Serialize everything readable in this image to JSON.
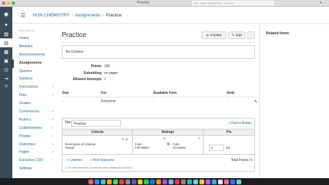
{
  "browser": {
    "tab_title": "Practice",
    "url": "ibe - WIBF 400000000 - Genuine",
    "colors": {
      "close": "#ff5f57",
      "min": "#febc2e",
      "max": "#28c840"
    }
  },
  "global_nav": {
    "items": [
      "account-icon",
      "dashboard-icon",
      "courses-icon",
      "calendar-icon",
      "inbox-icon",
      "history-icon",
      "commons-icon",
      "help-icon"
    ]
  },
  "breadcrumb": {
    "course": "HON CHEMISTRY",
    "section": "Assignments",
    "current": "Practice"
  },
  "course_nav": {
    "term": "2020-2021 S2",
    "items": [
      {
        "label": "Home",
        "hidden": false,
        "selected": false
      },
      {
        "label": "Modules",
        "hidden": false,
        "selected": false
      },
      {
        "label": "Announcements",
        "hidden": false,
        "selected": false
      },
      {
        "label": "Assignments",
        "hidden": false,
        "selected": true
      },
      {
        "label": "Quizzes",
        "hidden": false,
        "selected": false
      },
      {
        "label": "Syllabus",
        "hidden": false,
        "selected": false
      },
      {
        "label": "Discussions",
        "hidden": true,
        "selected": false
      },
      {
        "label": "Files",
        "hidden": true,
        "selected": false
      },
      {
        "label": "Grades",
        "hidden": false,
        "selected": false
      },
      {
        "label": "Conferences",
        "hidden": true,
        "selected": false
      },
      {
        "label": "Rubrics",
        "hidden": true,
        "selected": false
      },
      {
        "label": "Collaborations",
        "hidden": true,
        "selected": false
      },
      {
        "label": "People",
        "hidden": true,
        "selected": false
      },
      {
        "label": "Outcomes",
        "hidden": true,
        "selected": false
      },
      {
        "label": "Pages",
        "hidden": true,
        "selected": false
      },
      {
        "label": "Exclusive CSO",
        "hidden": true,
        "selected": false
      },
      {
        "label": "Settings",
        "hidden": false,
        "selected": false
      }
    ]
  },
  "assignment": {
    "title": "Practice",
    "publish_label": "Publish",
    "edit_label": "Edit",
    "more_label": "⋮",
    "description": "No Content",
    "details": [
      {
        "key": "Points",
        "value": "100"
      },
      {
        "key": "Submitting",
        "value": "on paper"
      },
      {
        "key": "Allowed Attempts",
        "value": "1"
      }
    ],
    "due_table": {
      "headers": [
        "Due",
        "For",
        "Available from",
        "Until"
      ],
      "row": [
        "-",
        "Everyone",
        "-",
        "-"
      ]
    }
  },
  "rubric": {
    "title_label": "Title:",
    "title_value": "Practice",
    "find_label": "Find a Rubric",
    "headers": {
      "criteria": "Criteria",
      "ratings": "Ratings",
      "pts": "Pts"
    },
    "criterion": {
      "description": "Description of criterion",
      "range": "Range",
      "ratings": [
        {
          "pts": "5 pts",
          "label": "Full Marks"
        },
        {
          "pts": "0 pts",
          "label": "No Marks"
        }
      ],
      "points": "5",
      "points_unit": "pts"
    },
    "add_criterion": "+ Criterion",
    "find_outcome": "Find Outcome",
    "total": "Total Points: 5",
    "option_text": "I'll write free-form comments when assessing students"
  },
  "right_sidebar": {
    "heading": "Related Items"
  },
  "dock": {
    "apps": [
      "#ff5f57",
      "#2d8cff",
      "#40c8e0",
      "#f5a623",
      "#4cd964",
      "#ff3b30",
      "#8e8e93",
      "#5856d6",
      "#ffcc00",
      "#34c759",
      "#007aff",
      "#ff9500",
      "#af52de",
      "#5ac8fa",
      "#ff2d55",
      "#a2845e",
      "#30b0c7",
      "#64d2ff",
      "#ffd60a",
      "#bf5af2",
      "#32ade6",
      "#e5e5ea",
      "#ff6482",
      "#0a84ff",
      "#66d4cf"
    ]
  }
}
